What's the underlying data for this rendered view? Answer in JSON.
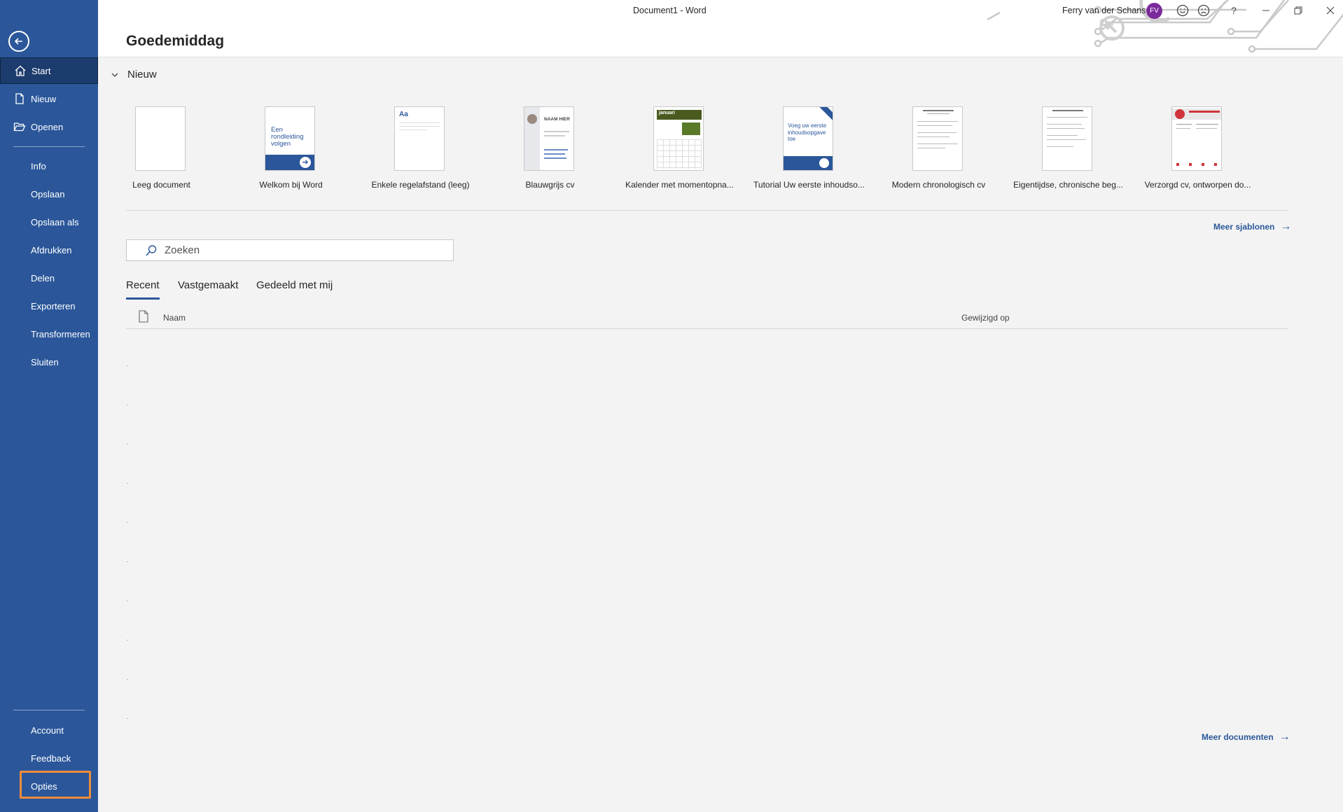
{
  "window": {
    "title": "Document1  -  Word",
    "user_name": "Ferry van der Schans",
    "user_initials": "FV",
    "help_label": "?"
  },
  "sidebar": {
    "items": [
      {
        "label": "Start",
        "icon": "home-icon"
      },
      {
        "label": "Nieuw",
        "icon": "new-document-icon"
      },
      {
        "label": "Openen",
        "icon": "folder-open-icon"
      },
      {
        "label": "Info"
      },
      {
        "label": "Opslaan"
      },
      {
        "label": "Opslaan als"
      },
      {
        "label": "Afdrukken"
      },
      {
        "label": "Delen"
      },
      {
        "label": "Exporteren"
      },
      {
        "label": "Transformeren"
      },
      {
        "label": "Sluiten"
      }
    ],
    "bottom_items": [
      {
        "label": "Account"
      },
      {
        "label": "Feedback"
      },
      {
        "label": "Opties"
      }
    ]
  },
  "main": {
    "greeting": "Goedemiddag",
    "new_section": {
      "label": "Nieuw",
      "templates": [
        {
          "label": "Leeg document"
        },
        {
          "label": "Welkom bij Word",
          "thumb_text": "Een rondleiding volgen"
        },
        {
          "label": "Enkele regelafstand (leeg)",
          "thumb_text": "Aa"
        },
        {
          "label": "Blauwgrijs cv",
          "thumb_text": "NAAM HIER"
        },
        {
          "label": "Kalender met momentopna...",
          "thumb_text": "januari"
        },
        {
          "label": "Tutorial Uw eerste inhoudso...",
          "thumb_text": "Voeg uw eerste inhoudsopgave toe"
        },
        {
          "label": "Modern chronologisch cv"
        },
        {
          "label": "Eigentijdse, chronische beg..."
        },
        {
          "label": "Verzorgd cv, ontworpen do..."
        }
      ],
      "more_templates": "Meer sjablonen"
    },
    "search": {
      "placeholder": "Zoeken"
    },
    "tabs": [
      {
        "label": "Recent"
      },
      {
        "label": "Vastgemaakt"
      },
      {
        "label": "Gedeeld met mij"
      }
    ],
    "list_columns": {
      "name": "Naam",
      "modified": "Gewijzigd op"
    },
    "more_documents": "Meer documenten"
  },
  "colors": {
    "accent": "#2b579a",
    "sidebar_active": "#1d3c6e",
    "highlight": "#f08c3a",
    "avatar": "#7b2a9b"
  }
}
